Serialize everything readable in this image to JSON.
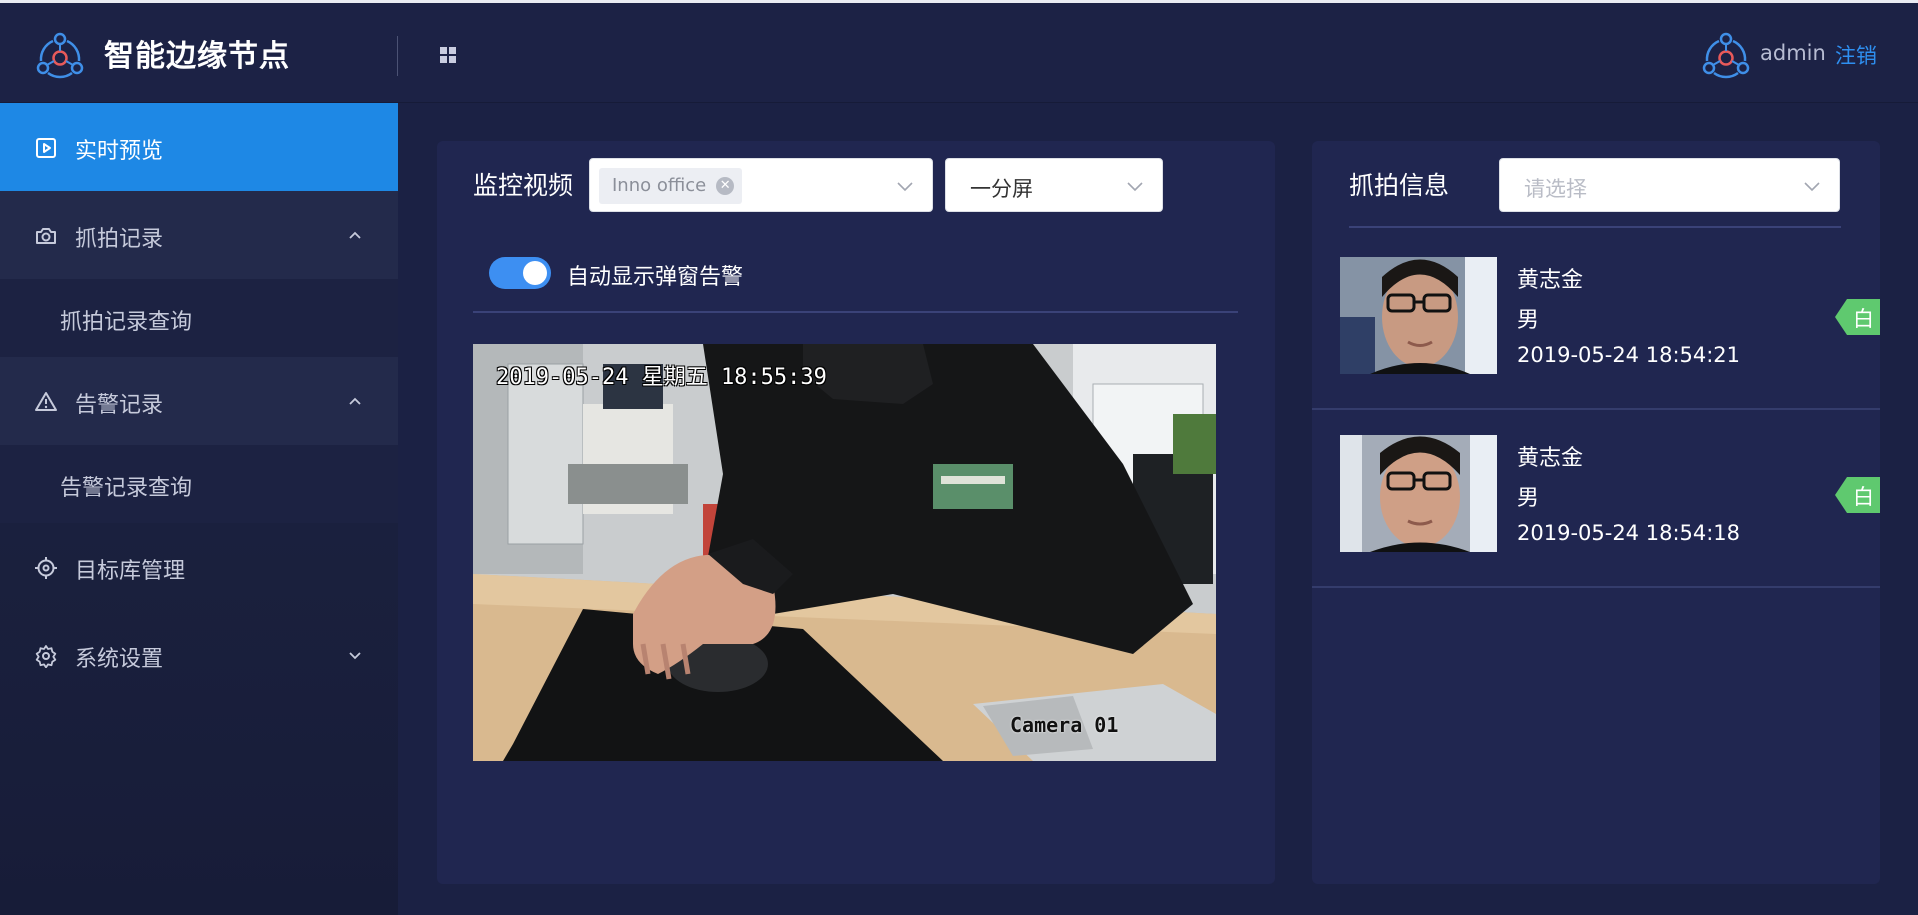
{
  "header": {
    "app_title": "智能边缘节点",
    "apps_icon": "grid-icon",
    "username": "admin",
    "logout_label": "注销"
  },
  "sidebar": {
    "items": [
      {
        "label": "实时预览",
        "icon": "play-square-icon",
        "state": "active"
      },
      {
        "label": "抓拍记录",
        "icon": "camera-icon",
        "state": "expanded",
        "children": [
          {
            "label": "抓拍记录查询"
          }
        ]
      },
      {
        "label": "告警记录",
        "icon": "warning-icon",
        "state": "expanded",
        "children": [
          {
            "label": "告警记录查询"
          }
        ]
      },
      {
        "label": "目标库管理",
        "icon": "target-icon"
      },
      {
        "label": "系统设置",
        "icon": "gear-icon",
        "state": "collapsed"
      }
    ]
  },
  "monitor": {
    "title": "监控视频",
    "camera_select": {
      "tag": "Inno office"
    },
    "layout_select": {
      "value": "一分屏"
    },
    "auto_popup_toggle": {
      "label": "自动显示弹窗告警",
      "on": true
    },
    "video": {
      "osd_time": "2019-05-24 星期五 18:55:39",
      "osd_camera": "Camera 01"
    }
  },
  "capture": {
    "title": "抓拍信息",
    "select_placeholder": "请选择",
    "records": [
      {
        "name": "黄志金",
        "gender": "男",
        "time": "2019-05-24 18:54:21",
        "badge": "白"
      },
      {
        "name": "黄志金",
        "gender": "男",
        "time": "2019-05-24 18:54:18",
        "badge": "白"
      }
    ]
  },
  "colors": {
    "background": "#1b2144",
    "panel": "#202650",
    "accent": "#1e88e5",
    "logout_link": "#2e8ff0",
    "badge_green": "#5fc96f"
  }
}
